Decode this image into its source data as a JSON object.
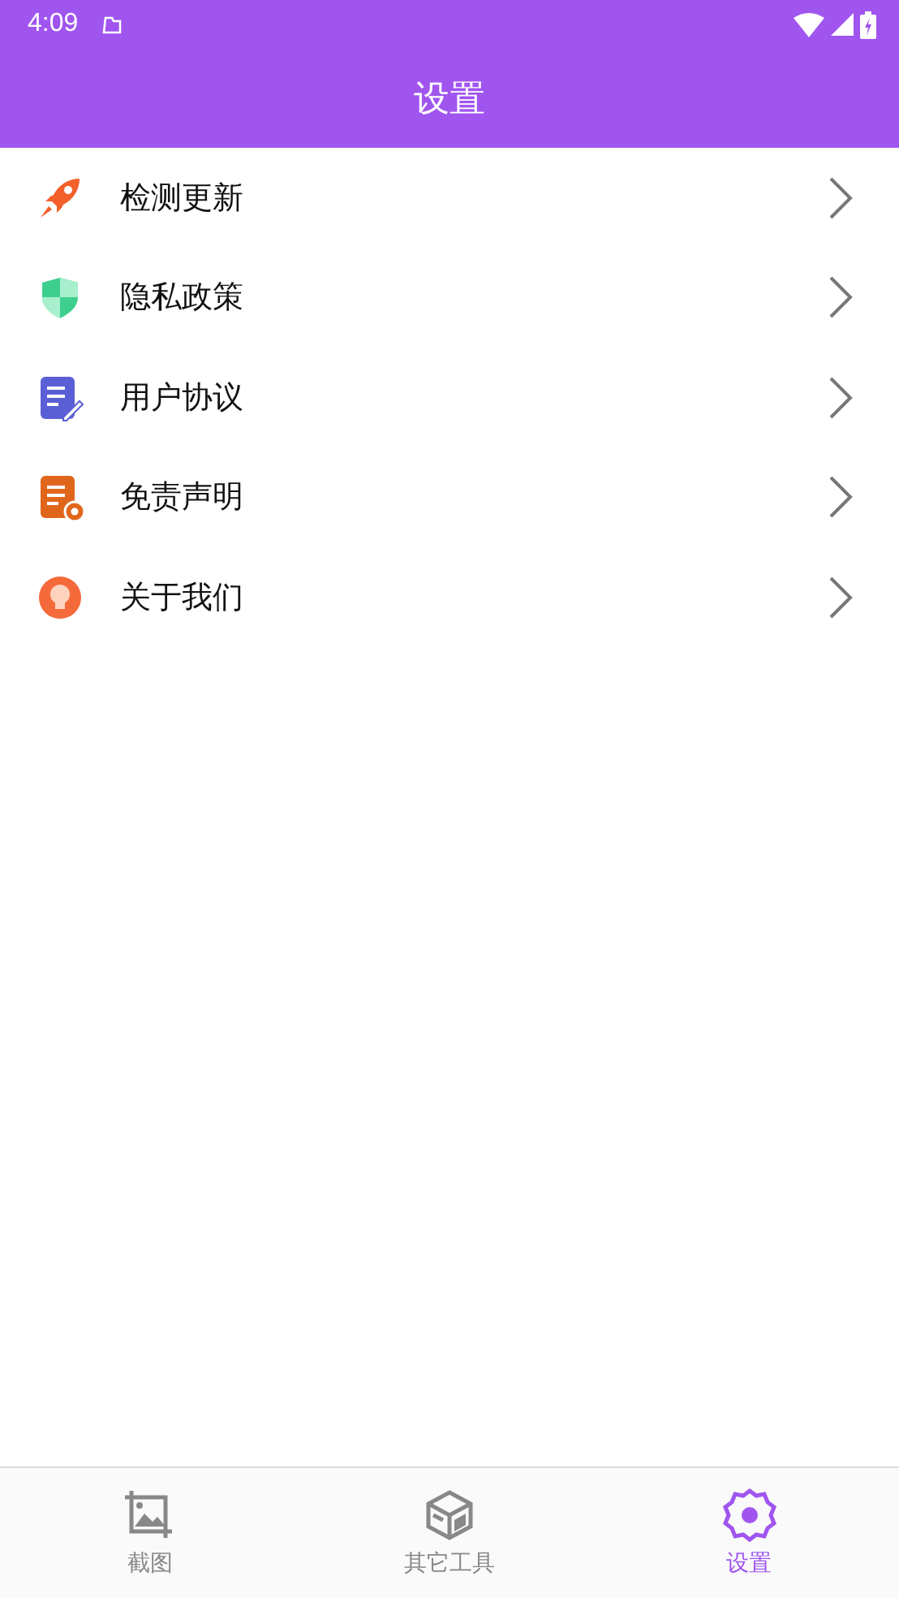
{
  "status_bar": {
    "time": "4:09"
  },
  "header": {
    "title": "设置"
  },
  "menu": [
    {
      "label": "检测更新",
      "kind": "rocket"
    },
    {
      "label": "隐私政策",
      "kind": "shield"
    },
    {
      "label": "用户协议",
      "kind": "document"
    },
    {
      "label": "免责声明",
      "kind": "disclaimer"
    },
    {
      "label": "关于我们",
      "kind": "about"
    }
  ],
  "tabs": [
    {
      "label": "截图",
      "kind": "crop",
      "selected": false
    },
    {
      "label": "其它工具",
      "kind": "box",
      "selected": false
    },
    {
      "label": "设置",
      "kind": "settings",
      "selected": true
    }
  ]
}
